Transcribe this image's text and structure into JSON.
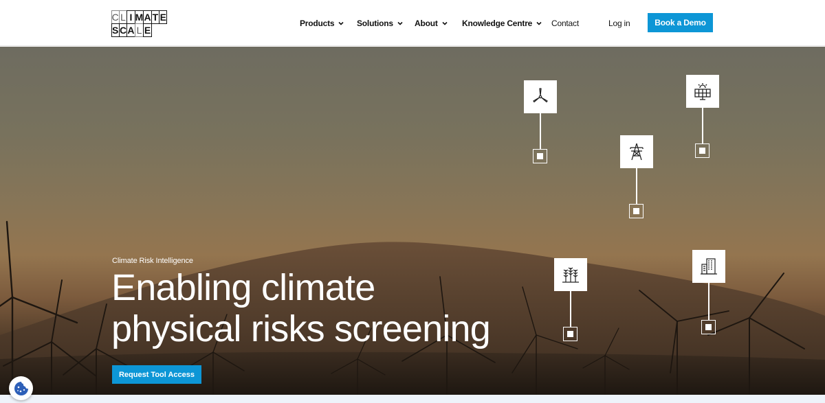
{
  "logo": {
    "row1": [
      "C",
      "L",
      "I",
      "M",
      "A",
      "T",
      "E"
    ],
    "row2": [
      "S",
      "C",
      "A",
      "L",
      "E",
      "",
      ""
    ]
  },
  "nav": {
    "items": [
      {
        "label": "Products",
        "has_dropdown": true
      },
      {
        "label": "Solutions",
        "has_dropdown": true
      },
      {
        "label": "About",
        "has_dropdown": true
      },
      {
        "label": "Knowledge Centre",
        "has_dropdown": true
      },
      {
        "label": "Contact",
        "has_dropdown": false
      }
    ],
    "login_label": "Log in",
    "demo_label": "Book a Demo"
  },
  "hero": {
    "eyebrow": "Climate Risk Intelligence",
    "headline_line1": "Enabling climate",
    "headline_line2": "physical risks screening",
    "cta_label": "Request Tool Access"
  },
  "pins": [
    {
      "icon": "wind-turbine-icon"
    },
    {
      "icon": "solar-panel-icon"
    },
    {
      "icon": "power-pylon-icon"
    },
    {
      "icon": "crops-icon"
    },
    {
      "icon": "buildings-icon"
    }
  ],
  "colors": {
    "accent": "#0d96d6",
    "header_bg": "#ffffff",
    "text_dark": "#111111",
    "hero_text": "#ffffff"
  },
  "cookie": {
    "icon": "cookie-icon"
  }
}
